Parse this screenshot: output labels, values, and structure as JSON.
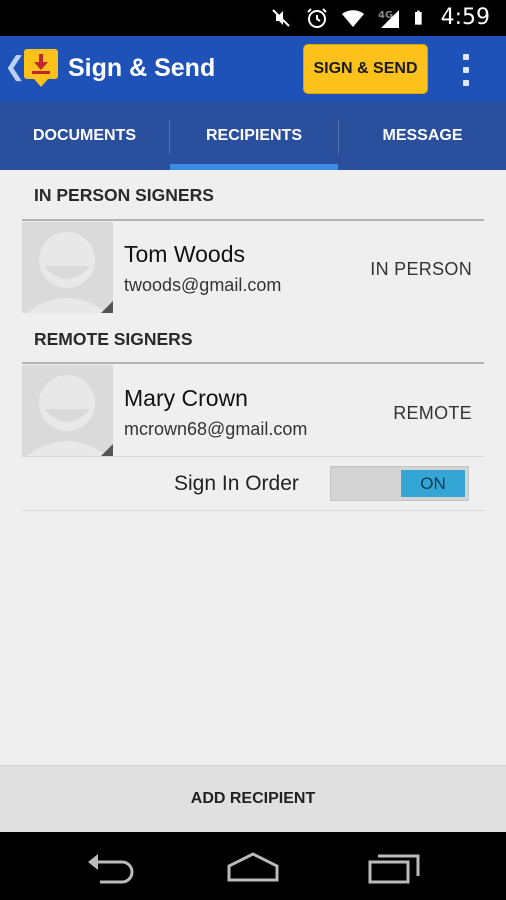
{
  "status_bar": {
    "time": "4:59",
    "icons": [
      "mute-icon",
      "alarm-icon",
      "wifi-icon",
      "4g-lte-icon",
      "signal-icon",
      "battery-icon"
    ],
    "network": "4G"
  },
  "app_bar": {
    "title": "Sign & Send",
    "primary_action": "SIGN & SEND",
    "brand_color": "#1f52b8",
    "accent_color": "#fcc21b"
  },
  "tabs": [
    {
      "label": "DOCUMENTS",
      "selected": false
    },
    {
      "label": "RECIPIENTS",
      "selected": true
    },
    {
      "label": "MESSAGE",
      "selected": false
    }
  ],
  "sections": {
    "in_person": {
      "header": "IN PERSON SIGNERS",
      "signers": [
        {
          "name": "Tom Woods",
          "email": "twoods@gmail.com",
          "type": "IN PERSON"
        }
      ]
    },
    "remote": {
      "header": "REMOTE SIGNERS",
      "signers": [
        {
          "name": "Mary Crown",
          "email": "mcrown68@gmail.com",
          "type": "REMOTE"
        }
      ],
      "sign_in_order": {
        "label": "Sign In Order",
        "state": "ON"
      }
    }
  },
  "footer": {
    "add_recipient": "ADD RECIPIENT"
  },
  "nav_bar": {
    "buttons": [
      "back-icon",
      "home-icon",
      "recents-icon"
    ]
  }
}
